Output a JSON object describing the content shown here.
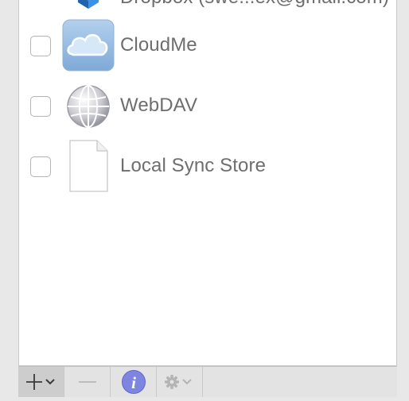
{
  "accounts": [
    {
      "label": "Dropbox (swe...ex@gmail.com)",
      "icon": "dropbox-icon",
      "checked": false
    },
    {
      "label": "CloudMe",
      "icon": "cloudme-icon",
      "checked": false
    },
    {
      "label": "WebDAV",
      "icon": "webdav-globe-icon",
      "checked": false
    },
    {
      "label": "Local Sync Store",
      "icon": "document-icon",
      "checked": false
    }
  ],
  "toolbar": {
    "add": "add-icon",
    "add_menu": "chevron-down-icon",
    "remove": "minus-icon",
    "info": "info-icon",
    "info_glyph": "i",
    "settings": "gear-icon",
    "settings_menu": "chevron-down-icon"
  },
  "colors": {
    "panel_bg": "#ffffff",
    "label": "#6e6e6e",
    "info_blue": "#7d85e0",
    "toolbar_bg": "#e3e3e3"
  }
}
